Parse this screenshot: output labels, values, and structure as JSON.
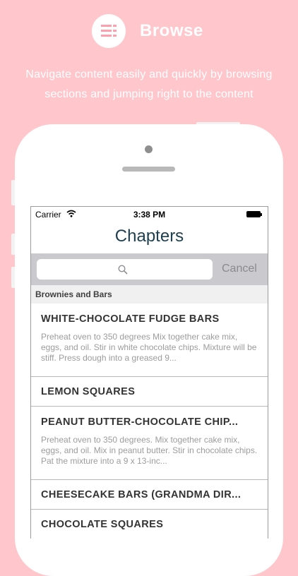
{
  "hero": {
    "title": "Browse",
    "subtitle_line1": "Navigate content easily and quickly by browsing",
    "subtitle_line2": "sections and jumping right to the content",
    "icon": "list-menu-icon"
  },
  "status_bar": {
    "carrier": "Carrier",
    "time": "3:38 PM"
  },
  "nav": {
    "title": "Chapters"
  },
  "search": {
    "placeholder": "",
    "cancel_label": "Cancel"
  },
  "section": {
    "header": "Brownies and Bars"
  },
  "rows": [
    {
      "title": "WHITE-CHOCOLATE FUDGE BARS",
      "desc": "Preheat oven to 350 degrees Mix together cake mix, eggs, and oil. Stir in white chocolate chips. Mixture will be stiff. Press dough into a greased 9..."
    },
    {
      "title": "LEMON SQUARES"
    },
    {
      "title": "PEANUT BUTTER-CHOCOLATE CHIP...",
      "desc": "Preheat oven to 350 degrees. Mix together cake mix, eggs, and oil. Mix in peanut butter. Stir in chocolate chips. Pat the mixture into a 9 x 13-inc..."
    },
    {
      "title": "CHEESECAKE BARS (GRANDMA DIR..."
    },
    {
      "title": "CHOCOLATE SQUARES"
    }
  ],
  "colors": {
    "background": "#ffc6cc",
    "nav_title": "#1f3f4f",
    "search_bar": "#c9c9ce"
  }
}
